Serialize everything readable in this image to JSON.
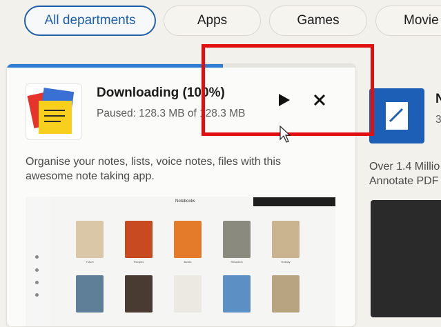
{
  "filters": [
    "All departments",
    "Apps",
    "Games",
    "Movie"
  ],
  "download_card": {
    "title": "Downloading (100%)",
    "status": "Paused: 128.3 MB of 128.3 MB",
    "progress": 0.62,
    "play_icon": "play-icon",
    "close_icon": "close-icon",
    "description": "Organise your notes, lists, voice notes, files with this awesome note taking app.",
    "screenshot": {
      "header": "Notebooks",
      "notebooks_row1": [
        "Travel",
        "Recipes",
        "Books",
        "Research",
        "Holiday"
      ],
      "notebooks_row2": [
        "",
        "",
        "",
        "",
        ""
      ]
    }
  },
  "next_card": {
    "title": "N",
    "subtitle": "3",
    "description_line1": "Over 1.4 Millio",
    "description_line2": "Annotate PDF"
  },
  "colors": {
    "accent": "#1f5fa8",
    "progress": "#2d7dd2",
    "highlight": "#e01010"
  }
}
